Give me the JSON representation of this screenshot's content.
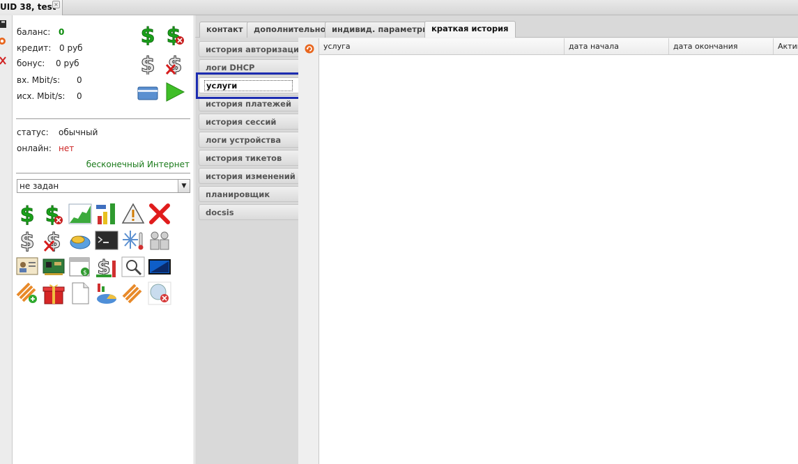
{
  "window": {
    "tab_title": "UID 38, test",
    "close_glyph": "×"
  },
  "mini_toolbar": [
    "save-icon",
    "refresh-icon",
    "delete-icon"
  ],
  "info": {
    "balance_label": "баланс:",
    "balance_value": "0",
    "credit_label": "кредит:",
    "credit_value": "0 руб",
    "bonus_label": "бонус:",
    "bonus_value": "0 руб",
    "in_label": "вх. Mbit/s:",
    "in_value": "0",
    "out_label": "исх. Mbit/s:",
    "out_value": "0",
    "status_label": "статус:",
    "status_value": "обычный",
    "online_label": "онлайн:",
    "online_value": "нет",
    "tariff": "бесконечный Интернет",
    "select_value": "не задан",
    "colors": {
      "balance": "#0a8a0a",
      "online": "#cc2222",
      "tariff": "#1a7a1a",
      "selection": "#1c2cb0"
    }
  },
  "top_tabs": [
    {
      "label": "контакт"
    },
    {
      "label": "дополнительно"
    },
    {
      "label": "индивид. параметры"
    },
    {
      "label": "краткая история",
      "active": true
    }
  ],
  "side_tabs": [
    {
      "label": "история авторизации"
    },
    {
      "label": "логи DHCP"
    },
    {
      "label": "услуги",
      "active": true
    },
    {
      "label": "история платежей"
    },
    {
      "label": "история сессий"
    },
    {
      "label": "логи устройства"
    },
    {
      "label": "история тикетов"
    },
    {
      "label": "история изменений"
    },
    {
      "label": "планировщик"
    },
    {
      "label": "docsis"
    }
  ],
  "grid": {
    "columns": [
      "услуга",
      "дата начала",
      "дата окончания",
      "Актив"
    ]
  }
}
